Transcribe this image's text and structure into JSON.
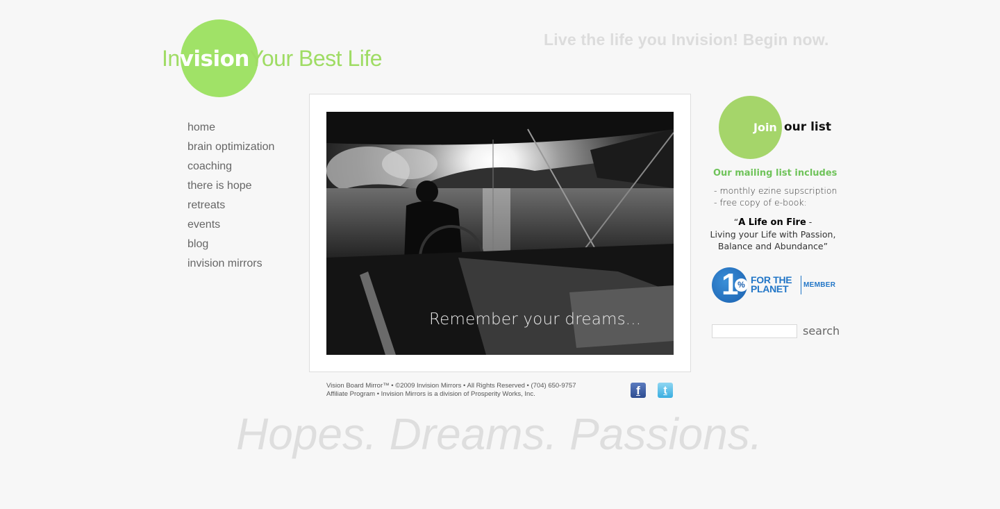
{
  "header": {
    "logo": {
      "prefix": "In",
      "highlight": "vision",
      "suffix": "Your Best Life"
    },
    "tagline": "Live the life you Invision! Begin now."
  },
  "nav": {
    "items": [
      {
        "label": "home"
      },
      {
        "label": "brain optimization"
      },
      {
        "label": "coaching"
      },
      {
        "label": "there is hope"
      },
      {
        "label": "retreats"
      },
      {
        "label": "events"
      },
      {
        "label": "blog"
      },
      {
        "label": "invision mirrors"
      }
    ]
  },
  "hero": {
    "caption": "Remember your dreams...",
    "image_alt": "black-and-white photo of a man steering a sailboat into the sun"
  },
  "footer": {
    "line1": "Vision Board Mirror™ • ©2009 Invision Mirrors • All Rights Reserved • (704) 650-9757",
    "line2": "Affiliate Program • Invision Mirrors is a division of Prosperity Works, Inc.",
    "social": {
      "facebook": "f",
      "twitter": "t"
    }
  },
  "slogan": "Hopes. Dreams. Passions.",
  "sidebar": {
    "join": {
      "highlight": "Join",
      "rest": "our list"
    },
    "mailing_heading": "Our mailing list includes",
    "mailing_items": [
      "- monthly ezine supscription",
      "- free copy of e-book:"
    ],
    "ebook": {
      "open_quote": "“",
      "title": "A Life on Fire",
      "dash": " -",
      "subtitle_line1": "Living your Life with Passion,",
      "subtitle_line2": "Balance and Abundance”"
    },
    "badge": {
      "number": "1",
      "percent": "%",
      "line1": "FOR THE",
      "line2": "PLANET",
      "member": "MEMBER"
    },
    "search": {
      "value": "",
      "placeholder": "",
      "button_label": "search"
    }
  },
  "colors": {
    "brand_green": "#a0e267",
    "heading_green": "#6fc35a",
    "badge_blue": "#2276c7",
    "background": "#f7f7f7"
  }
}
